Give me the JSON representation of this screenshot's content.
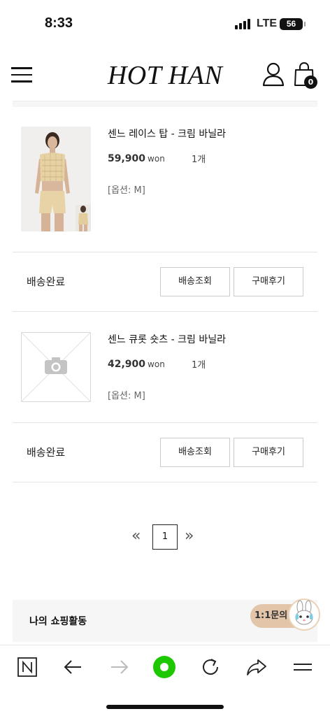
{
  "status_bar": {
    "time": "8:33",
    "network": "LTE",
    "battery": "56"
  },
  "header": {
    "logo": "HOT HAN",
    "cart_count": "0"
  },
  "orders": [
    {
      "name": "센느 레이스 탑 - 크림 바닐라",
      "price": "59,900",
      "currency": "won",
      "qty": "1개",
      "option": "[옵션: M]",
      "status": "배송완료",
      "track_label": "배송조회",
      "review_label": "구매후기"
    },
    {
      "name": "센느 큐롯 숏츠 - 크림 바닐라",
      "price": "42,900",
      "currency": "won",
      "qty": "1개",
      "option": "[옵션: M]",
      "status": "배송완료",
      "track_label": "배송조회",
      "review_label": "구매후기"
    }
  ],
  "pagination": {
    "prev": "«",
    "current": "1",
    "next": "»"
  },
  "activity": {
    "title": "나의 쇼핑활동",
    "chat_label": "1:1문의"
  },
  "colors": {
    "accent_green": "#1ec800",
    "chat_pill": "#e3c6a9"
  },
  "toolbar_icons": [
    "naver-n-icon",
    "back-arrow-icon",
    "forward-arrow-icon",
    "green-home-icon",
    "refresh-icon",
    "share-icon",
    "menu-icon"
  ]
}
